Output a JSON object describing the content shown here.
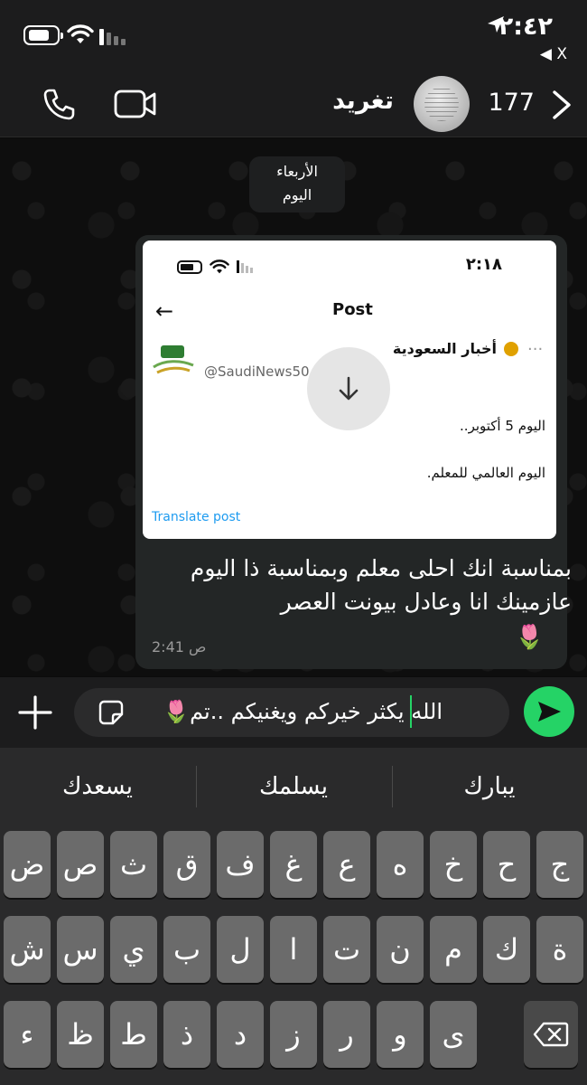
{
  "status_bar": {
    "time": "٢:٤٢",
    "back_app": "◀ X"
  },
  "header": {
    "contact_name": "تغريد",
    "unread_count": "177"
  },
  "chat": {
    "date_pill": {
      "day": "الأربعاء",
      "label": "اليوم"
    },
    "message": {
      "text": "بمناسبة انك احلى معلم وبمناسبة ذا اليوم عازمينك انا وعادل بيونت العصر",
      "emoji": "🌷",
      "time": "2:41 ص",
      "screenshot": {
        "time": "٢:١٨",
        "title": "Post",
        "account_name": "أخبار السعودية",
        "handle": "@SaudiNews50",
        "line1": "اليوم 5 أكتوبر..",
        "line2": "اليوم العالمي للمعلم.",
        "translate": "Translate post"
      }
    }
  },
  "composer": {
    "text": "الله يكثر خيركم ويغنيكم ..تم🌷"
  },
  "keyboard": {
    "suggestions": [
      "يسعدك",
      "يسلمك",
      "يبارك"
    ],
    "row1": [
      "ض",
      "ص",
      "ث",
      "ق",
      "ف",
      "غ",
      "ع",
      "ه",
      "خ",
      "ح",
      "ج"
    ],
    "row2": [
      "ش",
      "س",
      "ي",
      "ب",
      "ل",
      "ا",
      "ت",
      "ن",
      "م",
      "ك",
      "ة"
    ],
    "row3": [
      "ء",
      "ظ",
      "ط",
      "ذ",
      "د",
      "ز",
      "ر",
      "و",
      "ى"
    ]
  }
}
